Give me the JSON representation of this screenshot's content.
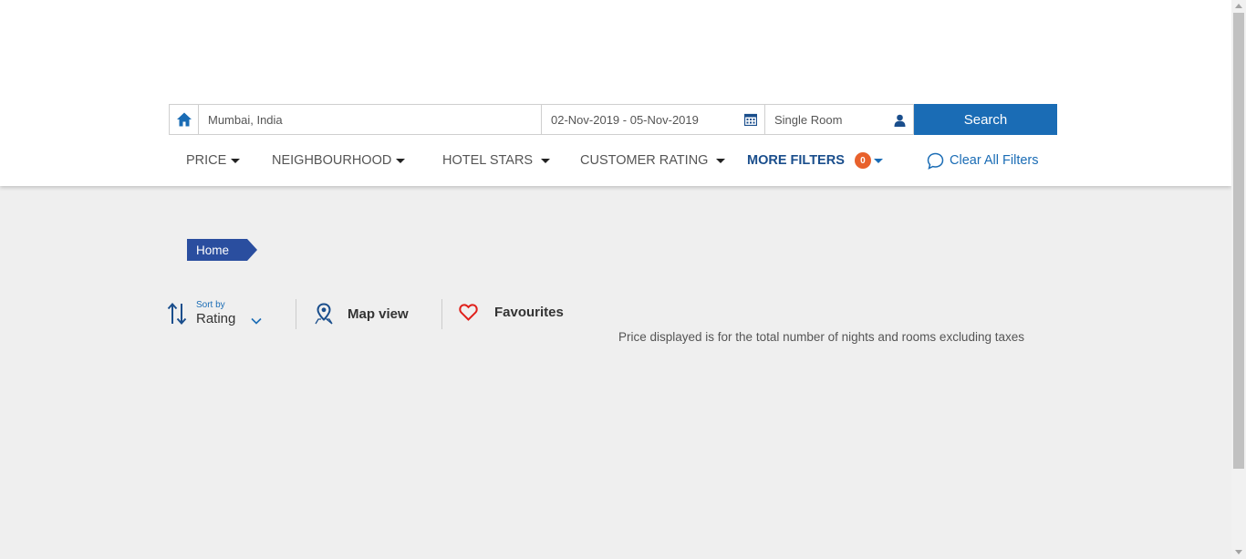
{
  "search": {
    "destination": "Mumbai, India",
    "dates": "02-Nov-2019 - 05-Nov-2019",
    "rooms": "Single Room",
    "button_label": "Search"
  },
  "filters": {
    "price": "PRICE",
    "neighbourhood": "NEIGHBOURHOOD",
    "hotel_stars": "HOTEL STARS",
    "customer_rating": "CUSTOMER RATING",
    "more_filters": "MORE FILTERS",
    "more_filters_count": "0",
    "clear_all": "Clear All Filters"
  },
  "breadcrumb": {
    "home": "Home"
  },
  "toolbar": {
    "sort_label": "Sort by",
    "sort_value": "Rating",
    "map_view": "Map view",
    "favourites": "Favourites"
  },
  "price_note": "Price displayed is for the total number of nights and rooms excluding taxes",
  "colors": {
    "primary_blue": "#1a6cb5",
    "breadcrumb_blue": "#2a4e9f",
    "badge_orange": "#e8612c",
    "heart_red": "#e0201b"
  },
  "icons": {
    "home": "home-icon",
    "calendar": "calendar-icon",
    "user": "user-icon",
    "chat": "chat-bubble-icon",
    "sort": "sort-arrows-icon",
    "map": "map-pin-icon",
    "heart": "heart-icon"
  }
}
